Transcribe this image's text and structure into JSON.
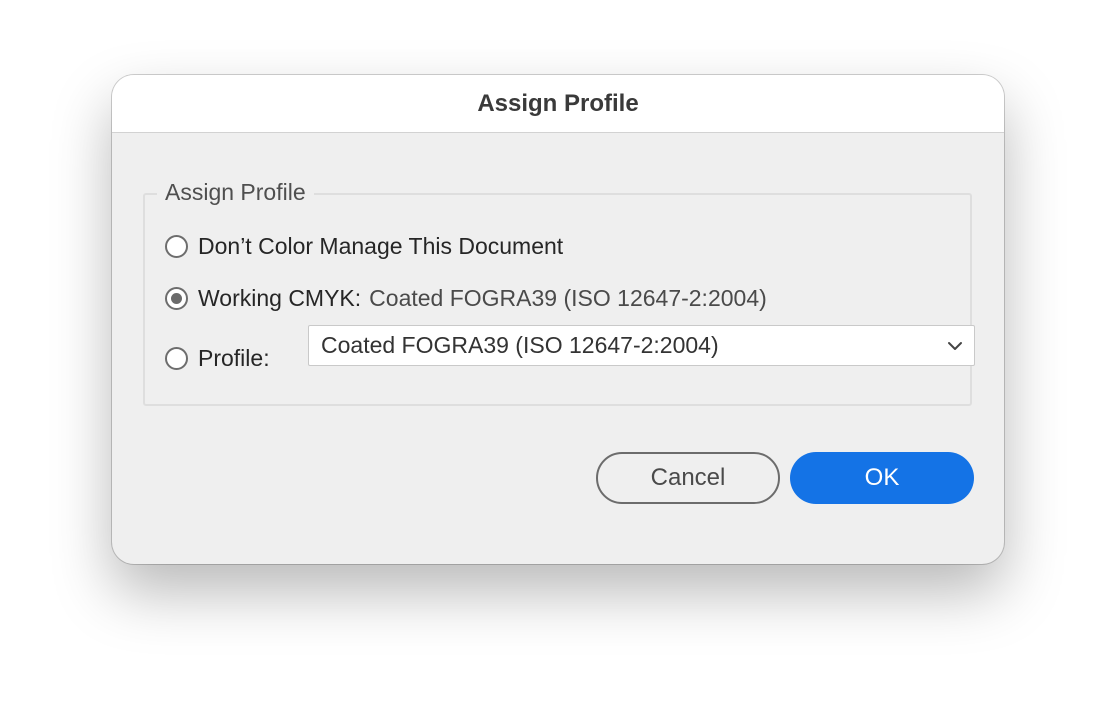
{
  "dialog": {
    "title": "Assign Profile",
    "group_label": "Assign Profile",
    "options": {
      "no_manage": {
        "label": "Don’t Color Manage This Document",
        "selected": false
      },
      "working": {
        "label": "Working CMYK:",
        "value": "Coated FOGRA39 (ISO 12647-2:2004)",
        "selected": true
      },
      "profile": {
        "label": "Profile:",
        "selected": false
      }
    },
    "profile_select": {
      "value": "Coated FOGRA39 (ISO 12647-2:2004)",
      "icon": "chevron-down-icon"
    },
    "buttons": {
      "cancel": "Cancel",
      "ok": "OK"
    }
  },
  "colors": {
    "accent": "#1473e6",
    "dialog_bg": "#efefef"
  }
}
